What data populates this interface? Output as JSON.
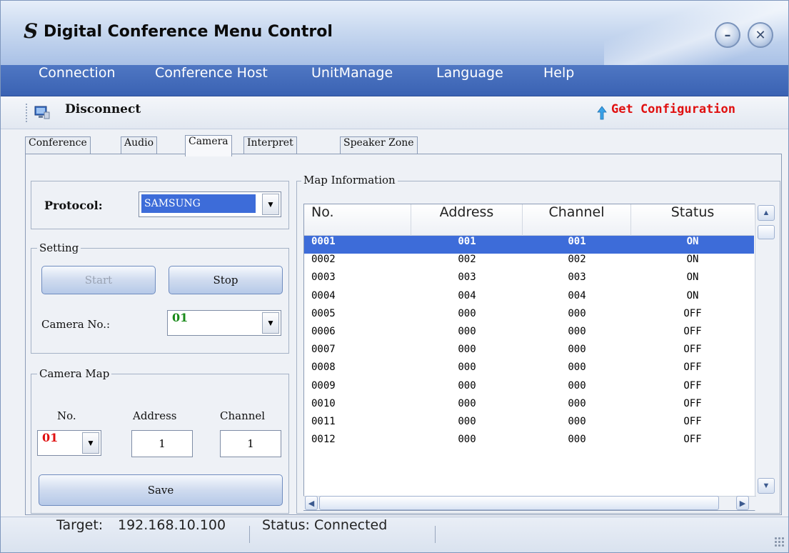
{
  "app": {
    "title": "Digital Conference Menu Control",
    "logo_glyph": "S",
    "minimize_glyph": "–",
    "close_glyph": "✕"
  },
  "menu": {
    "items": [
      "Connection",
      "Conference Host",
      "UnitManage",
      "Language",
      "Help"
    ]
  },
  "toolbar": {
    "disconnect_label": "Disconnect",
    "get_config_label": "Get Configuration",
    "colors": {
      "get_config": "#e01010"
    }
  },
  "tabs": {
    "items": [
      "Conference",
      "Audio",
      "Camera",
      "Interpret",
      "Speaker Zone"
    ],
    "active": "Camera"
  },
  "protocol": {
    "label": "Protocol:",
    "value": "SAMSUNG"
  },
  "setting": {
    "title": "Setting",
    "start_label": "Start",
    "stop_label": "Stop",
    "camera_no_label": "Camera No.:",
    "camera_no_value": "01"
  },
  "camera_map": {
    "title": "Camera Map",
    "no_header": "No.",
    "address_header": "Address",
    "channel_header": "Channel",
    "no_value": "01",
    "address_value": "1",
    "channel_value": "1",
    "save_label": "Save"
  },
  "map_info": {
    "title": "Map Information",
    "columns": [
      "No.",
      "Address",
      "Channel",
      "Status"
    ],
    "rows": [
      [
        "0001",
        "001",
        "001",
        "ON"
      ],
      [
        "0002",
        "002",
        "002",
        "ON"
      ],
      [
        "0003",
        "003",
        "003",
        "ON"
      ],
      [
        "0004",
        "004",
        "004",
        "ON"
      ],
      [
        "0005",
        "000",
        "000",
        "OFF"
      ],
      [
        "0006",
        "000",
        "000",
        "OFF"
      ],
      [
        "0007",
        "000",
        "000",
        "OFF"
      ],
      [
        "0008",
        "000",
        "000",
        "OFF"
      ],
      [
        "0009",
        "000",
        "000",
        "OFF"
      ],
      [
        "0010",
        "000",
        "000",
        "OFF"
      ],
      [
        "0011",
        "000",
        "000",
        "OFF"
      ],
      [
        "0012",
        "000",
        "000",
        "OFF"
      ]
    ],
    "selected_row": 0
  },
  "status_bar": {
    "target_label": "Target:",
    "target_value": "192.168.10.100",
    "status_text": "Status: Connected"
  },
  "icons": {
    "arrow_down": "▼",
    "arrow_up": "▲",
    "arrow_left": "◀",
    "arrow_right": "▶"
  }
}
